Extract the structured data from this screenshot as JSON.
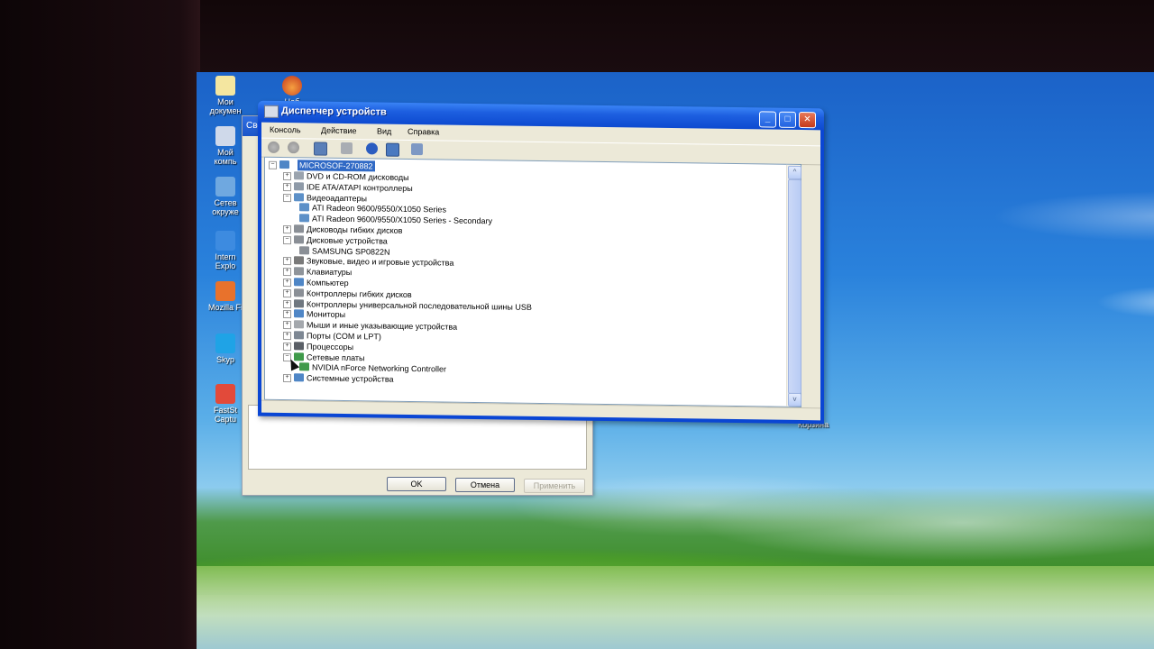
{
  "desktop_icons": [
    {
      "label": "Мои\nдокумен",
      "icon": "my-documents-icon",
      "color": "#f4e6a0"
    },
    {
      "label": "Мой\nкомпь",
      "icon": "my-computer-icon",
      "color": "#cfd9ea"
    },
    {
      "label": "Сетев\nокруже",
      "icon": "network-places-icon",
      "color": "#6fa8e0"
    },
    {
      "label": "Intern\nExplo",
      "icon": "internet-explorer-icon",
      "color": "#3d8be0"
    },
    {
      "label": "Mozilla Fi",
      "icon": "firefox-icon",
      "color": "#e8722c"
    },
    {
      "label": "Skyp",
      "icon": "skype-icon",
      "color": "#1fa3e6"
    },
    {
      "label": "FastSt\nCaptu",
      "icon": "faststone-capture-icon",
      "color": "#e24a3a"
    }
  ],
  "top_icon_label": "Ноб",
  "recycle_bin": {
    "label": "Корзина",
    "icon": "recycle-bin-icon"
  },
  "bg_dialog": {
    "title": "Сво",
    "ok": "OK",
    "cancel": "Отмена",
    "apply": "Применить"
  },
  "window": {
    "title": "Диспетчер устройств",
    "menu": [
      "Консоль",
      "Действие",
      "Вид",
      "Справка"
    ],
    "tree": {
      "root": "MICROSOF-270882",
      "items": [
        {
          "label": "DVD и CD-ROM дисководы",
          "level": 1,
          "expander": "+",
          "icon": "dvd-drive-icon",
          "color": "#9aa3ae"
        },
        {
          "label": "IDE ATA/ATAPI контроллеры",
          "level": 1,
          "expander": "+",
          "icon": "ide-controller-icon",
          "color": "#8e9aa8"
        },
        {
          "label": "Видеоадаптеры",
          "level": 1,
          "expander": "-",
          "icon": "display-adapter-icon",
          "color": "#5c90c8"
        },
        {
          "label": "ATI Radeon 9600/9550/X1050 Series",
          "level": 2,
          "expander": "",
          "icon": "display-adapter-icon",
          "color": "#5c90c8"
        },
        {
          "label": "ATI Radeon 9600/9550/X1050 Series - Secondary",
          "level": 2,
          "expander": "",
          "icon": "display-adapter-icon",
          "color": "#5c90c8"
        },
        {
          "label": "Дисководы гибких дисков",
          "level": 1,
          "expander": "+",
          "icon": "floppy-drive-icon",
          "color": "#8a8f96"
        },
        {
          "label": "Дисковые устройства",
          "level": 1,
          "expander": "-",
          "icon": "disk-drive-icon",
          "color": "#8a8f96"
        },
        {
          "label": "SAMSUNG SP0822N",
          "level": 2,
          "expander": "",
          "icon": "disk-drive-icon",
          "color": "#8a8f96"
        },
        {
          "label": "Звуковые, видео и игровые устройства",
          "level": 1,
          "expander": "+",
          "icon": "sound-device-icon",
          "color": "#7a7a7a"
        },
        {
          "label": "Клавиатуры",
          "level": 1,
          "expander": "+",
          "icon": "keyboard-icon",
          "color": "#8f949a"
        },
        {
          "label": "Компьютер",
          "level": 1,
          "expander": "+",
          "icon": "computer-icon",
          "color": "#4f86c6"
        },
        {
          "label": "Контроллеры гибких дисков",
          "level": 1,
          "expander": "+",
          "icon": "floppy-controller-icon",
          "color": "#8a8f96"
        },
        {
          "label": "Контроллеры универсальной последовательной шины USB",
          "level": 1,
          "expander": "+",
          "icon": "usb-controller-icon",
          "color": "#6f7780"
        },
        {
          "label": "Мониторы",
          "level": 1,
          "expander": "+",
          "icon": "monitor-icon",
          "color": "#4f86c6"
        },
        {
          "label": "Мыши и иные указывающие устройства",
          "level": 1,
          "expander": "+",
          "icon": "mouse-icon",
          "color": "#a4a8ad"
        },
        {
          "label": "Порты (COM и LPT)",
          "level": 1,
          "expander": "+",
          "icon": "port-icon",
          "color": "#7d8793"
        },
        {
          "label": "Процессоры",
          "level": 1,
          "expander": "+",
          "icon": "processor-icon",
          "color": "#5a5f66"
        },
        {
          "label": "Сетевые платы",
          "level": 1,
          "expander": "-",
          "icon": "network-adapter-icon",
          "color": "#3f9a4a"
        },
        {
          "label": "NVIDIA nForce Networking Controller",
          "level": 2,
          "expander": "",
          "icon": "network-adapter-icon",
          "color": "#3f9a4a"
        },
        {
          "label": "Системные устройства",
          "level": 1,
          "expander": "+",
          "icon": "system-device-icon",
          "color": "#4f86c6"
        }
      ]
    },
    "toolbar": [
      "back-icon",
      "forward-icon",
      "properties-pane-icon",
      "print-icon",
      "help-icon",
      "console-tree-icon",
      "scan-hardware-icon"
    ]
  }
}
